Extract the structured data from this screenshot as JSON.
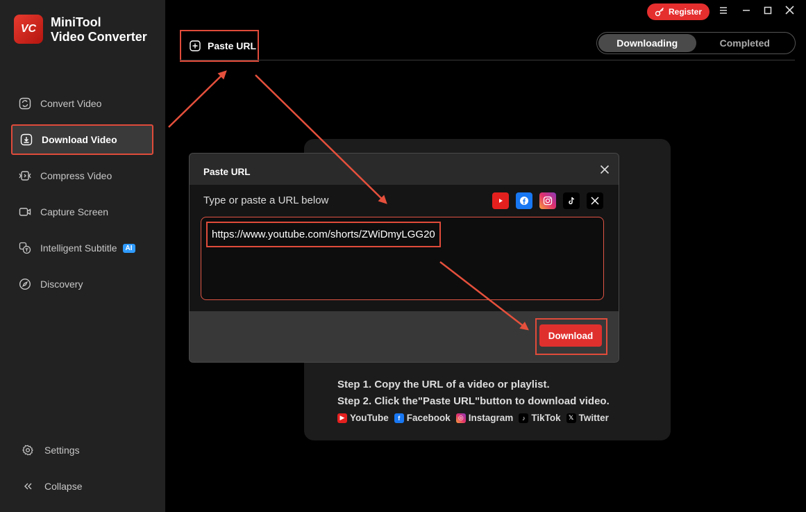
{
  "app": {
    "title_line1": "MiniTool",
    "title_line2": "Video Converter",
    "logo_letters": "VC"
  },
  "colors": {
    "accent": "#e0302e",
    "highlight": "#e04b3a",
    "ai_badge": "#2f9bff"
  },
  "sidebar": {
    "items": [
      {
        "label": "Convert Video",
        "icon": "convert-icon"
      },
      {
        "label": "Download Video",
        "icon": "download-icon",
        "active": true
      },
      {
        "label": "Compress Video",
        "icon": "compress-icon"
      },
      {
        "label": "Capture Screen",
        "icon": "camera-icon"
      },
      {
        "label": "Intelligent Subtitle",
        "icon": "subtitle-icon",
        "badge": "AI"
      },
      {
        "label": "Discovery",
        "icon": "compass-icon"
      }
    ],
    "settings_label": "Settings",
    "collapse_label": "Collapse"
  },
  "topbar": {
    "register_label": "Register"
  },
  "toolbar": {
    "paste_url_label": "Paste URL"
  },
  "tabs": {
    "downloading": "Downloading",
    "completed": "Completed"
  },
  "help": {
    "step1": "Step 1. Copy the URL of a video or playlist.",
    "step2": "Step 2. Click the\"Paste URL\"button to download video.",
    "platforms": [
      "YouTube",
      "Facebook",
      "Instagram",
      "TikTok",
      "Twitter"
    ]
  },
  "dialog": {
    "title": "Paste URL",
    "instruction": "Type or paste a URL below",
    "url_value": "https://www.youtube.com/shorts/ZWiDmyLGG20",
    "download_label": "Download"
  }
}
